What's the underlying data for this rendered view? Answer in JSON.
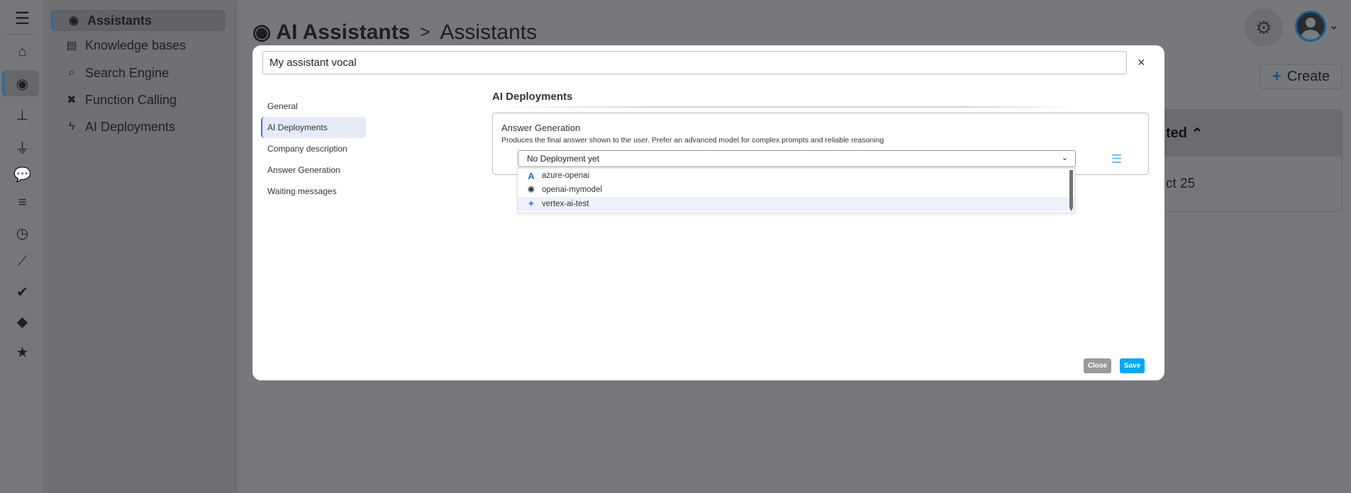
{
  "iconbar": {
    "icons": [
      "menu-icon",
      "home-icon",
      "brain-icon",
      "sitemap-icon",
      "plug-icon",
      "comments-icon",
      "database-icon",
      "clock-icon",
      "chart-line-icon",
      "check-circle-icon",
      "tag-icon",
      "star-icon"
    ]
  },
  "sidebar": {
    "items": [
      {
        "label": "Assistants",
        "icon": "brain-icon",
        "active": true
      },
      {
        "label": "Knowledge bases",
        "icon": "book-icon"
      },
      {
        "label": "Search Engine",
        "icon": "search-icon"
      },
      {
        "label": "Function Calling",
        "icon": "tools-icon"
      },
      {
        "label": "AI Deployments",
        "icon": "bolt-icon"
      }
    ]
  },
  "header": {
    "section": "AI Assistants",
    "separator": ">",
    "page": "Assistants",
    "create_label": "Create"
  },
  "table": {
    "header_partial": "ted",
    "row_partial": "ct 25"
  },
  "modal": {
    "name_value": "My assistant vocal",
    "close_icon": "×",
    "nav": [
      {
        "label": "General"
      },
      {
        "label": "AI Deployments",
        "active": true
      },
      {
        "label": "Company description"
      },
      {
        "label": "Answer Generation"
      },
      {
        "label": "Waiting messages"
      }
    ],
    "section_title": "AI Deployments",
    "card": {
      "title": "Answer Generation",
      "description": "Produces the final answer shown to the user. Prefer an advanced model for complex prompts and reliable reasoning",
      "select_value": "No Deployment yet"
    },
    "options": [
      {
        "label": "azure-openai",
        "icon": "azure-icon"
      },
      {
        "label": "openai-mymodel",
        "icon": "openai-icon"
      },
      {
        "label": "vertex-ai-test",
        "icon": "vertex-sparkle-icon",
        "highlighted": true
      }
    ],
    "close_label": "Close",
    "save_label": "Save"
  },
  "colors": {
    "accent": "#00a8f5",
    "close_btn": "#9a9a98",
    "active_nav": "#e6eaf6"
  }
}
